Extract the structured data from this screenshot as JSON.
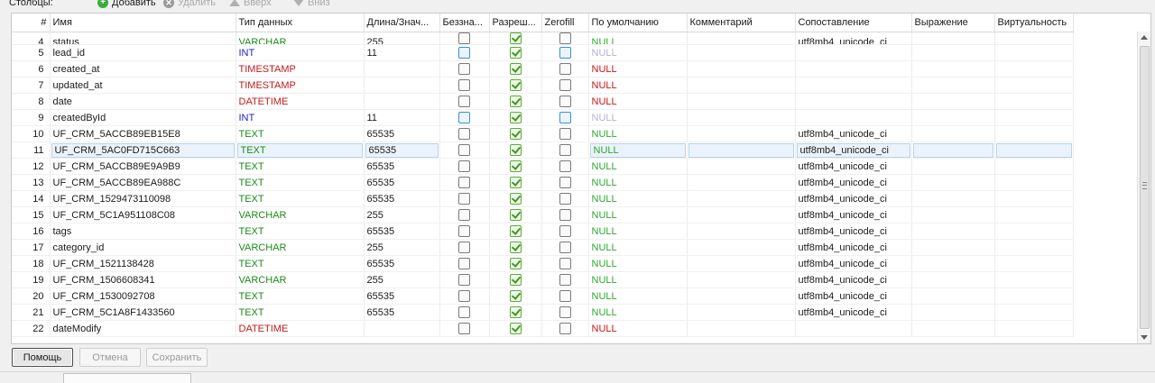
{
  "toolbar": {
    "label": "Столбцы:",
    "add": "Добавить",
    "remove": "Удалить",
    "up": "Вверх",
    "down": "Вниз"
  },
  "columns": [
    "#",
    "Имя",
    "Тип данных",
    "Длина/Знач...",
    "Беззна...",
    "Разреш...",
    "Zerofill",
    "По умолчанию",
    "Комментарий",
    "Сопоставление",
    "Выражение",
    "Виртуальность"
  ],
  "partial_row": {
    "num": "4",
    "name": "status",
    "type": "VARCHAR",
    "length": "255",
    "default": "NULL",
    "collation": "utf8mb4_unicode_ci"
  },
  "rows": [
    {
      "num": "5",
      "name": "lead_id",
      "type": "INT",
      "length": "11",
      "default": "NULL",
      "collation": ""
    },
    {
      "num": "6",
      "name": "created_at",
      "type": "TIMESTAMP",
      "length": "",
      "default": "NULL",
      "collation": ""
    },
    {
      "num": "7",
      "name": "updated_at",
      "type": "TIMESTAMP",
      "length": "",
      "default": "NULL",
      "collation": ""
    },
    {
      "num": "8",
      "name": "date",
      "type": "DATETIME",
      "length": "",
      "default": "NULL",
      "collation": ""
    },
    {
      "num": "9",
      "name": "createdById",
      "type": "INT",
      "length": "11",
      "default": "NULL",
      "collation": ""
    },
    {
      "num": "10",
      "name": "UF_CRM_5ACCB89EB15E8",
      "type": "TEXT",
      "length": "65535",
      "default": "NULL",
      "collation": "utf8mb4_unicode_ci"
    },
    {
      "num": "11",
      "name": "UF_CRM_5AC0FD715C663",
      "type": "TEXT",
      "length": "65535",
      "default": "NULL",
      "collation": "utf8mb4_unicode_ci"
    },
    {
      "num": "12",
      "name": "UF_CRM_5ACCB89E9A9B9",
      "type": "TEXT",
      "length": "65535",
      "default": "NULL",
      "collation": "utf8mb4_unicode_ci"
    },
    {
      "num": "13",
      "name": "UF_CRM_5ACCB89EA988C",
      "type": "TEXT",
      "length": "65535",
      "default": "NULL",
      "collation": "utf8mb4_unicode_ci"
    },
    {
      "num": "14",
      "name": "UF_CRM_1529473110098",
      "type": "TEXT",
      "length": "65535",
      "default": "NULL",
      "collation": "utf8mb4_unicode_ci"
    },
    {
      "num": "15",
      "name": "UF_CRM_5C1A951108C08",
      "type": "VARCHAR",
      "length": "255",
      "default": "NULL",
      "collation": "utf8mb4_unicode_ci"
    },
    {
      "num": "16",
      "name": "tags",
      "type": "TEXT",
      "length": "65535",
      "default": "NULL",
      "collation": "utf8mb4_unicode_ci"
    },
    {
      "num": "17",
      "name": "category_id",
      "type": "VARCHAR",
      "length": "255",
      "default": "NULL",
      "collation": "utf8mb4_unicode_ci"
    },
    {
      "num": "18",
      "name": "UF_CRM_1521138428",
      "type": "TEXT",
      "length": "65535",
      "default": "NULL",
      "collation": "utf8mb4_unicode_ci"
    },
    {
      "num": "19",
      "name": "UF_CRM_1506608341",
      "type": "VARCHAR",
      "length": "255",
      "default": "NULL",
      "collation": "utf8mb4_unicode_ci"
    },
    {
      "num": "20",
      "name": "UF_CRM_1530092708",
      "type": "TEXT",
      "length": "65535",
      "default": "NULL",
      "collation": "utf8mb4_unicode_ci"
    },
    {
      "num": "21",
      "name": "UF_CRM_5C1A8F1433560",
      "type": "TEXT",
      "length": "65535",
      "default": "NULL",
      "collation": "utf8mb4_unicode_ci"
    },
    {
      "num": "22",
      "name": "dateModify",
      "type": "DATETIME",
      "length": "",
      "default": "NULL",
      "collation": ""
    }
  ],
  "buttons": {
    "help": "Помощь",
    "cancel": "Отмена",
    "save": "Сохранить"
  }
}
